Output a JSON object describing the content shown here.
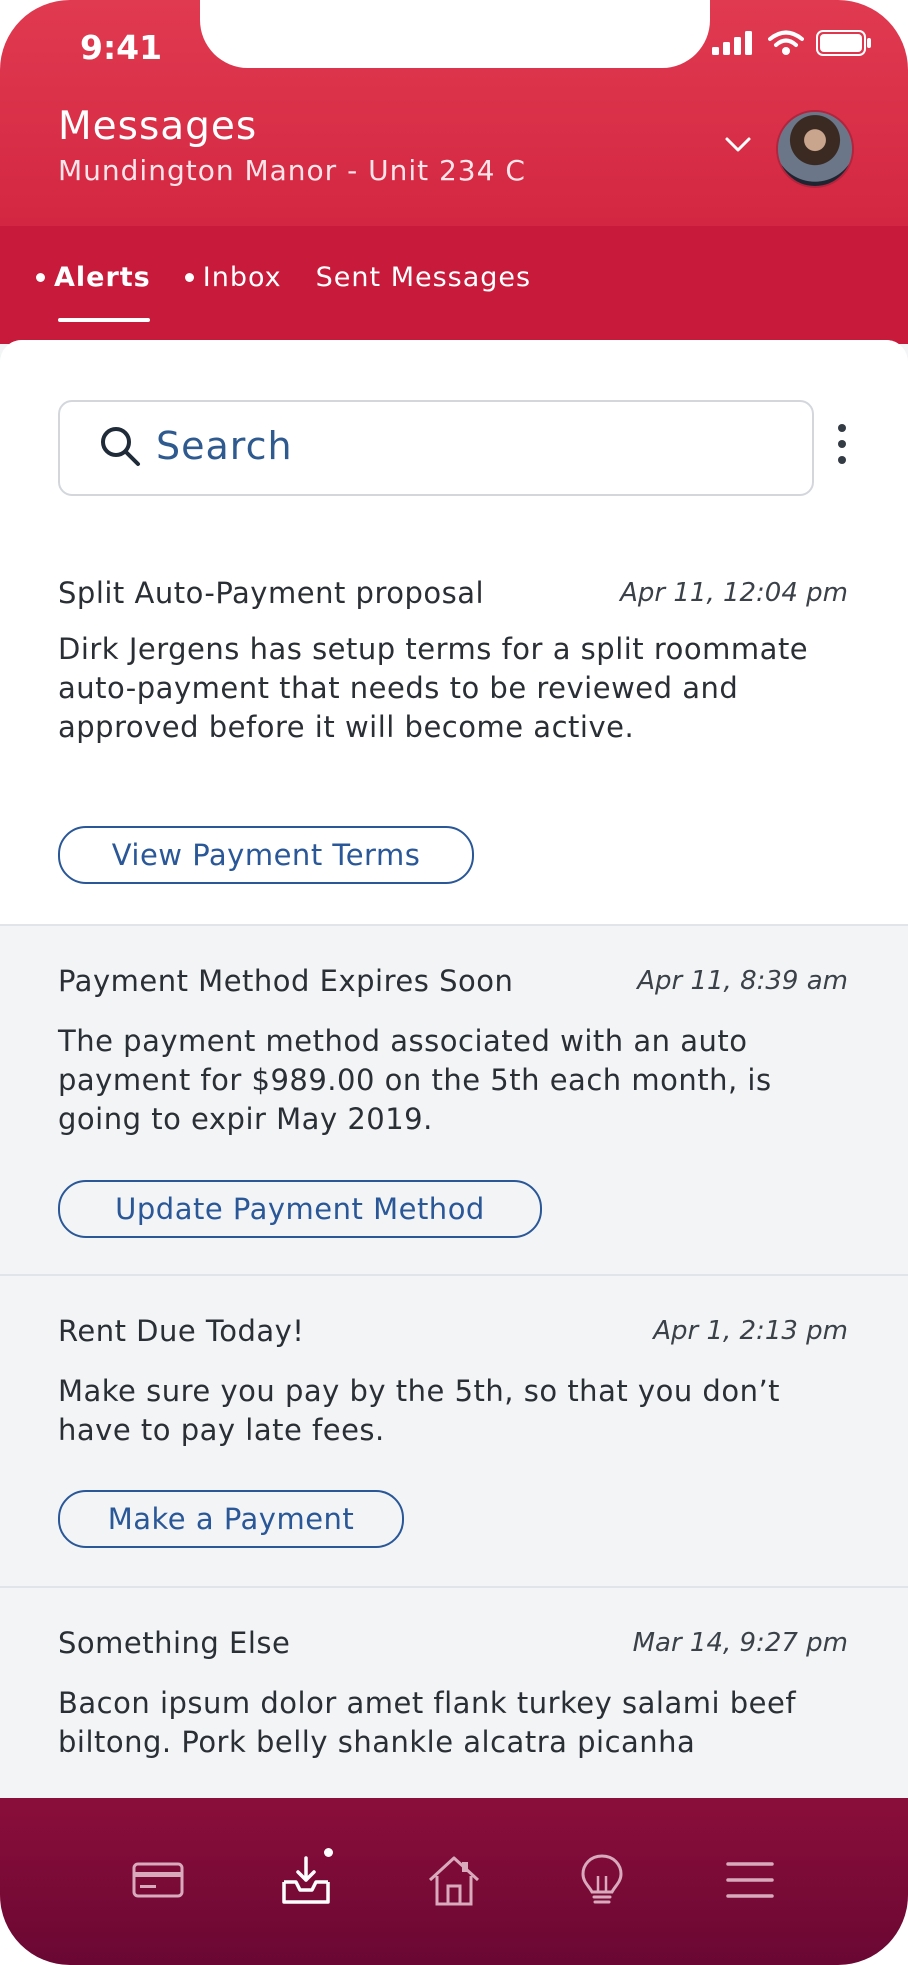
{
  "status": {
    "time": "9:41"
  },
  "header": {
    "title": "Messages",
    "subtitle": "Mundington Manor - Unit 234 C"
  },
  "tabs": [
    {
      "label": "Alerts",
      "active": true,
      "has_dot": true
    },
    {
      "label": "Inbox",
      "active": false,
      "has_dot": true
    },
    {
      "label": "Sent Messages",
      "active": false,
      "has_dot": false
    }
  ],
  "search": {
    "placeholder": "Search"
  },
  "messages": [
    {
      "title": "Split Auto-Payment proposal",
      "time": "Apr 11, 12:04 pm",
      "body": "Dirk Jergens has setup terms for a split roommate auto-payment that needs to be reviewed and approved before it will become active.",
      "action": "View Payment Terms"
    },
    {
      "title": "Payment Method Expires Soon",
      "time": "Apr 11, 8:39 am",
      "body": "The payment method associated with an auto payment for $989.00 on the 5th each month, is going to expir May 2019.",
      "action": "Update Payment Method"
    },
    {
      "title": "Rent Due Today!",
      "time": "Apr 1, 2:13 pm",
      "body": "Make sure you pay by the 5th, so that you don’t have to pay late fees.",
      "action": "Make a Payment"
    },
    {
      "title": "Something Else",
      "time": "Mar 14, 9:27 pm",
      "body": "Bacon ipsum dolor amet flank turkey salami beef biltong. Pork belly shankle alcatra picanha",
      "action": ""
    }
  ],
  "bottom_nav": [
    {
      "icon": "card-icon"
    },
    {
      "icon": "inbox-icon",
      "active": true,
      "has_dot": true
    },
    {
      "icon": "home-icon"
    },
    {
      "icon": "lightbulb-icon"
    },
    {
      "icon": "menu-icon"
    }
  ],
  "colors": {
    "brand_red": "#d62a44",
    "nav_maroon": "#6a0733",
    "link_blue": "#2a5797"
  }
}
